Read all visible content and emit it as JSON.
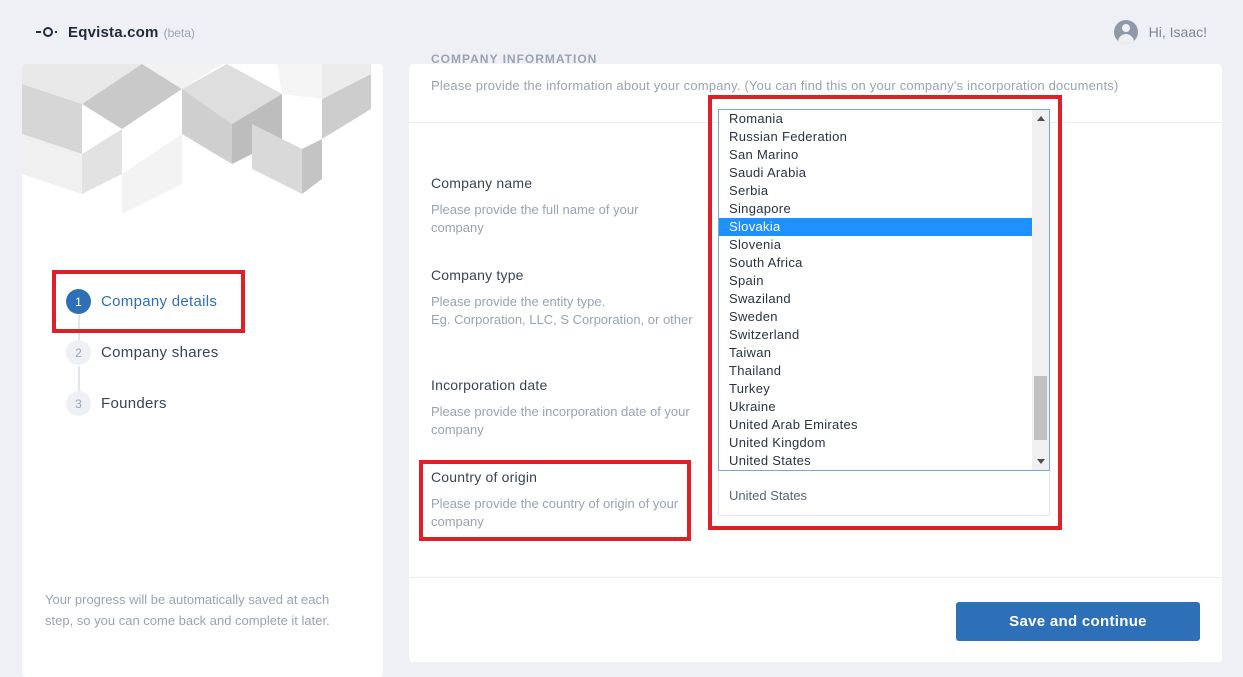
{
  "header": {
    "logo_text": "Eqvista.com",
    "logo_badge": "(beta)",
    "greeting": "Hi, Isaac!",
    "avatar_icon": "user-avatar-icon"
  },
  "sidebar": {
    "steps": [
      {
        "number": "1",
        "label": "Company details",
        "active": true
      },
      {
        "number": "2",
        "label": "Company shares",
        "active": false
      },
      {
        "number": "3",
        "label": "Founders",
        "active": false
      }
    ],
    "progress_note": "Your progress will be automatically saved at each step, so you can come back and complete it later."
  },
  "form": {
    "section_title": "COMPANY INFORMATION",
    "section_description": "Please provide the information about your company. (You can find this on your company's incorporation documents)",
    "fields": [
      {
        "label": "Company name",
        "help": "Please provide the full name of your company"
      },
      {
        "label": "Company type",
        "help": "Please provide the entity type.",
        "help2": "Eg. Corporation, LLC, S Corporation, or other"
      },
      {
        "label": "Incorporation date",
        "help": "Please provide the incorporation date of your company"
      },
      {
        "label": "Country of origin",
        "help": "Please provide the country of origin of your company"
      }
    ],
    "country_value": "United States",
    "country_options_visible": [
      "Romania",
      "Russian Federation",
      "San Marino",
      "Saudi Arabia",
      "Serbia",
      "Singapore",
      "Slovakia",
      "Slovenia",
      "South Africa",
      "Spain",
      "Swaziland",
      "Sweden",
      "Switzerland",
      "Taiwan",
      "Thailand",
      "Turkey",
      "Ukraine",
      "United Arab Emirates",
      "United Kingdom",
      "United States"
    ],
    "highlighted_option": "Slovakia",
    "save_label": "Save and continue"
  },
  "colors": {
    "primary": "#2e70b8",
    "highlight_option": "#1e90ff",
    "annotation_red": "#e01f26",
    "background": "#eef0f5"
  }
}
